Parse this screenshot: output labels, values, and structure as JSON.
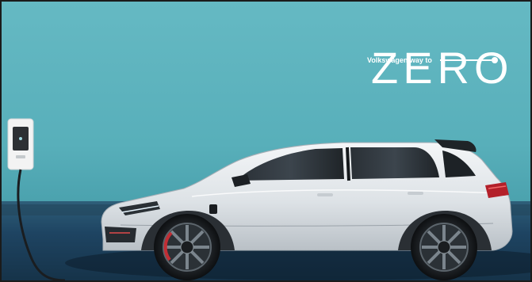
{
  "logo": {
    "word": "ZERO",
    "tagline": "Volkswagen way to"
  },
  "colors": {
    "wall": "#5bb1bb",
    "floor": "#1c3a55",
    "car_body": "#e6e9ec",
    "logo": "#ffffff"
  },
  "icons": {
    "charger": "wall-charger-icon",
    "car": "hatchback-car-icon"
  }
}
